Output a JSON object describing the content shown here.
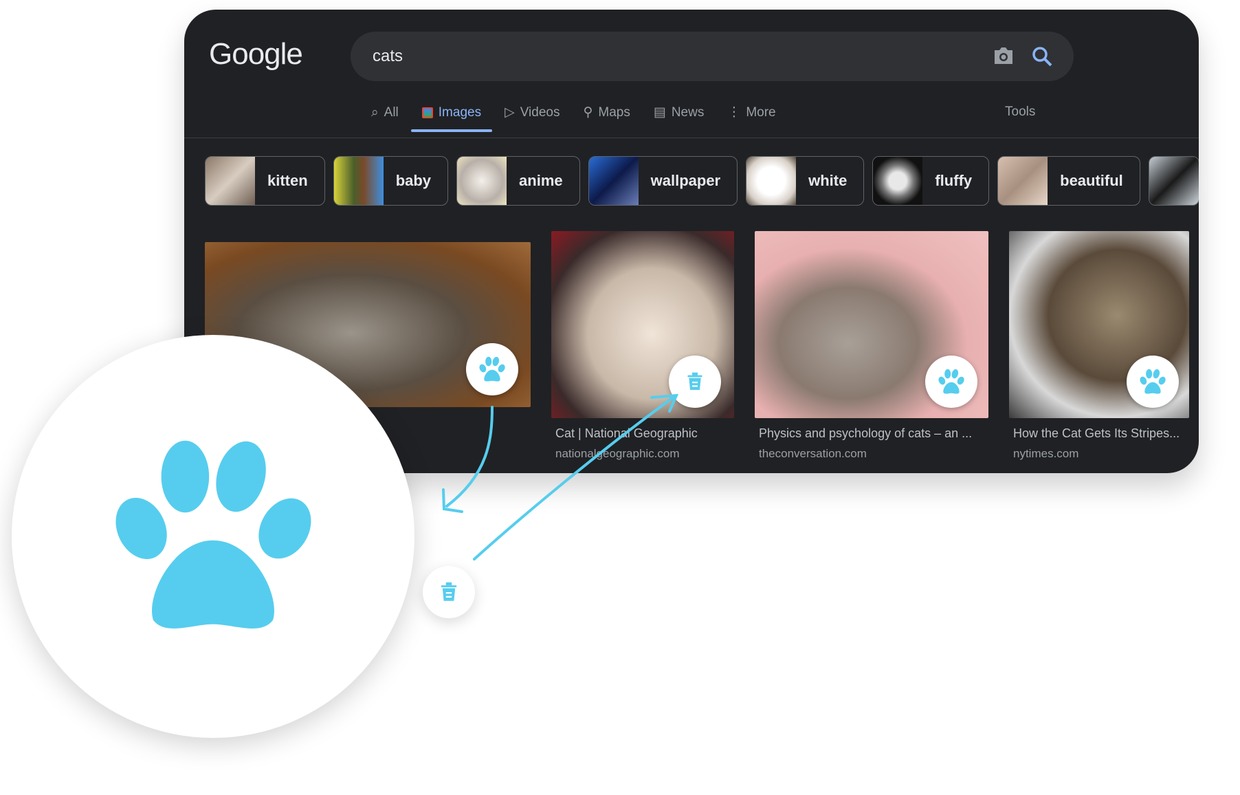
{
  "logo": "Google",
  "search": {
    "query": "cats"
  },
  "tabs": [
    {
      "label": "All",
      "icon": "search-icon"
    },
    {
      "label": "Images",
      "icon": "image-icon",
      "active": true
    },
    {
      "label": "Videos",
      "icon": "play-icon"
    },
    {
      "label": "Maps",
      "icon": "pin-icon"
    },
    {
      "label": "News",
      "icon": "news-icon"
    },
    {
      "label": "More",
      "icon": "dots-icon"
    }
  ],
  "tools": "Tools",
  "chips": [
    "kitten",
    "baby",
    "anime",
    "wallpaper",
    "white",
    "fluffy",
    "beautiful"
  ],
  "results": [
    {
      "title": "",
      "source": ""
    },
    {
      "title": "Cat | National Geographic",
      "source": "nationalgeographic.com"
    },
    {
      "title": "Physics and psychology of cats – an ...",
      "source": "theconversation.com"
    },
    {
      "title": "How the Cat Gets Its Stripes...",
      "source": "nytimes.com"
    }
  ],
  "colors": {
    "accent": "#56cdee",
    "bg": "#202124",
    "tab_active": "#8ab4f8"
  }
}
